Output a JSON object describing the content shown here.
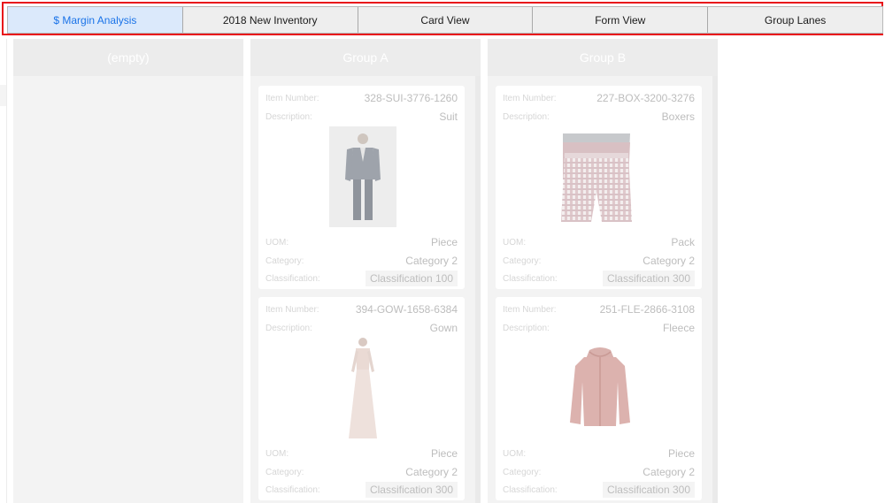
{
  "tabs": [
    {
      "label": "$ Margin Analysis",
      "active": true
    },
    {
      "label": "2018 New Inventory",
      "active": false
    },
    {
      "label": "Card View",
      "active": false
    },
    {
      "label": "Form View",
      "active": false
    },
    {
      "label": "Group Lanes",
      "active": false
    }
  ],
  "field_labels": {
    "item_number": "Item Number:",
    "description": "Description:",
    "uom": "UOM:",
    "category": "Category:",
    "classification": "Classification:"
  },
  "lanes": [
    {
      "title": "(empty)",
      "cards": []
    },
    {
      "title": "Group A",
      "cards": [
        {
          "item_number": "328-SUI-3776-1260",
          "description": "Suit",
          "image": "suit-image",
          "uom": "Piece",
          "category": "Category 2",
          "classification": "Classification 100"
        },
        {
          "item_number": "394-GOW-1658-6384",
          "description": "Gown",
          "image": "gown-image",
          "uom": "Piece",
          "category": "Category 2",
          "classification": "Classification 300"
        }
      ]
    },
    {
      "title": "Group B",
      "cards": [
        {
          "item_number": "227-BOX-3200-3276",
          "description": "Boxers",
          "image": "boxers-image",
          "uom": "Pack",
          "category": "Category 2",
          "classification": "Classification 300"
        },
        {
          "item_number": "251-FLE-2866-3108",
          "description": "Fleece",
          "image": "fleece-image",
          "uom": "Piece",
          "category": "Category 2",
          "classification": "Classification 300"
        }
      ]
    }
  ],
  "colors": {
    "highlight_border": "#e8121a",
    "active_tab_bg": "#dbe9fb",
    "active_tab_text": "#1a73e8"
  }
}
